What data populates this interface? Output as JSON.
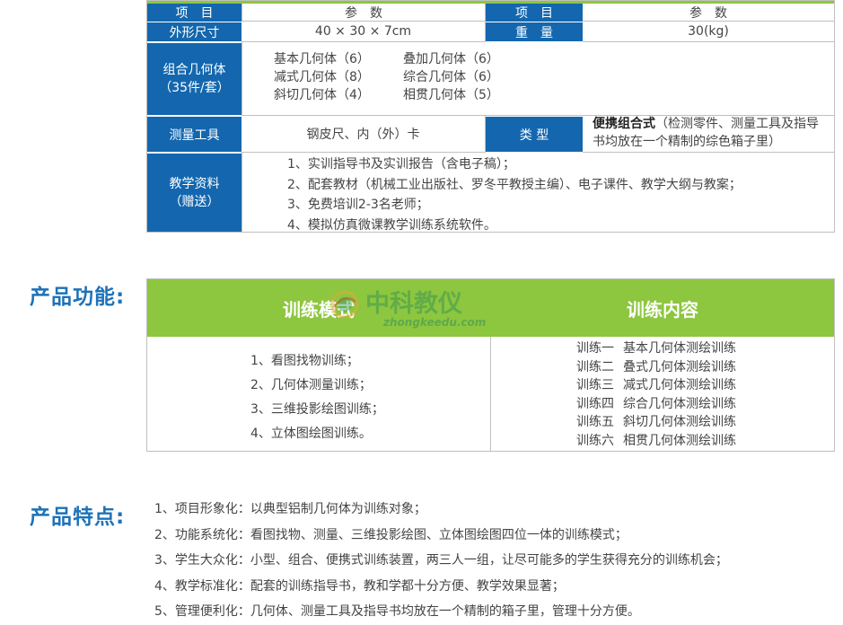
{
  "spec_table": {
    "header": {
      "item1": "项　目",
      "param1": "参　数",
      "item2": "项　目",
      "param2": "参　数"
    },
    "size": {
      "label": "外形尺寸",
      "value": "40 × 30 × 7cm"
    },
    "weight": {
      "label": "重　量",
      "value": "30(kg)"
    },
    "shapes": {
      "label_line1": "组合几何体",
      "label_line2": "（35件/套）",
      "items": [
        [
          "基本几何体（6）",
          "叠加几何体（6）"
        ],
        [
          "减式几何体（8）",
          "综合几何体（6）"
        ],
        [
          "斜切几何体（4）",
          "相贯几何体（5）"
        ]
      ]
    },
    "tools": {
      "label": "测量工具",
      "value": "钢皮尺、内（外）卡"
    },
    "type": {
      "label": "类 型",
      "value_bold": "便携组合式",
      "value_rest": "（检测零件、测量工具及指导书均放在一个精制的综色箱子里）"
    },
    "resources": {
      "label_line1": "教学资料",
      "label_line2": "（赠送）",
      "items": [
        "1、实训指导书及实训报告（含电子稿）；",
        "2、配套教材（机械工业出版社、罗冬平教授主编）、电子课件、教学大纲与教案；",
        "3、免费培训2-3名老师；",
        "4、模拟仿真微课教学训练系统软件。"
      ]
    }
  },
  "functions": {
    "title": "产品功能:",
    "col1_header": "训练模式",
    "col2_header": "训练内容",
    "modes": [
      "1、看图找物训练；",
      "2、几何体测量训练；",
      "3、三维投影绘图训练；",
      "4、立体图绘图训练。"
    ],
    "contents": [
      {
        "num": "训练一",
        "name": "基本几何体测绘训练"
      },
      {
        "num": "训练二",
        "name": "叠式几何体测绘训练"
      },
      {
        "num": "训练三",
        "name": "减式几何体测绘训练"
      },
      {
        "num": "训练四",
        "name": "综合几何体测绘训练"
      },
      {
        "num": "训练五",
        "name": "斜切几何体测绘训练"
      },
      {
        "num": "训练六",
        "name": "相贯几何体测绘训练"
      }
    ]
  },
  "watermark": {
    "brand": "中科教仪",
    "url": "zhongkeedu.com"
  },
  "features": {
    "title": "产品特点:",
    "items": [
      "1、项目形象化：以典型铝制几何体为训练对象；",
      "2、功能系统化：看图找物、测量、三维投影绘图、立体图绘图四位一体的训练模式；",
      "3、学生大众化：小型、组合、便携式训练装置，两三人一组，让尽可能多的学生获得充分的训练机会；",
      "4、教学标准化：配套的训练指导书，教和学都十分方便、教学效果显著；",
      "5、管理便利化：几何体、测量工具及指导书均放在一个精制的箱子里，管理十分方便。"
    ]
  },
  "colors": {
    "blue": "#1467ae",
    "green": "#8dc63f",
    "title_blue": "#1d72b8"
  }
}
